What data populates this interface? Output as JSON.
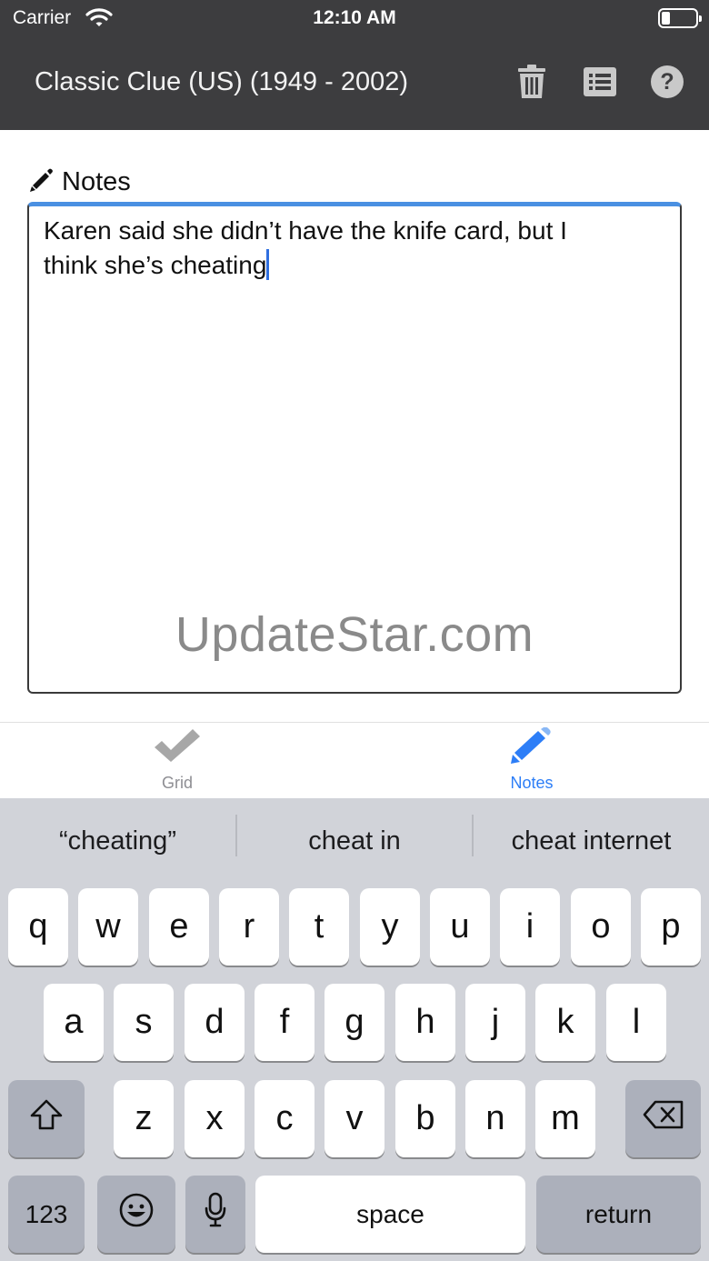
{
  "status_bar": {
    "carrier": "Carrier",
    "time": "12:10 AM"
  },
  "nav": {
    "title": "Classic Clue (US) (1949 - 2002)",
    "icons": [
      "trash-icon",
      "list-icon",
      "help-icon"
    ]
  },
  "notes": {
    "header_label": "Notes",
    "text_line1": "Karen said she didn’t have the knife card, but I",
    "text_line2": "think she’s cheating"
  },
  "watermark": "UpdateStar.com",
  "tabs": [
    {
      "label": "Grid",
      "icon": "checkmark-icon",
      "selected": false
    },
    {
      "label": "Notes",
      "icon": "pencil-icon",
      "selected": true
    }
  ],
  "keyboard": {
    "suggestions": [
      "“cheating”",
      "cheat in",
      "cheat internet"
    ],
    "row1": [
      "q",
      "w",
      "e",
      "r",
      "t",
      "y",
      "u",
      "i",
      "o",
      "p"
    ],
    "row2": [
      "a",
      "s",
      "d",
      "f",
      "g",
      "h",
      "j",
      "k",
      "l"
    ],
    "row3": [
      "z",
      "x",
      "c",
      "v",
      "b",
      "n",
      "m"
    ],
    "numbers_key": "123",
    "space_key": "space",
    "return_key": "return"
  },
  "colors": {
    "nav_background": "#3d3d3f",
    "accent": "#2d7ef7",
    "keyboard_background": "#d1d3d9"
  }
}
